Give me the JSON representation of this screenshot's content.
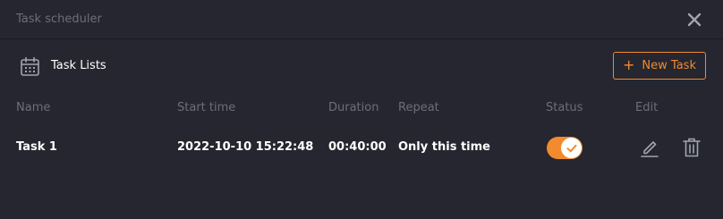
{
  "window": {
    "title": "Task scheduler"
  },
  "section": {
    "title": "Task Lists",
    "new_task_label": "New Task"
  },
  "table": {
    "columns": [
      "Name",
      "Start time",
      "Duration",
      "Repeat",
      "Status",
      "Edit"
    ],
    "rows": [
      {
        "name": "Task 1",
        "start_time": "2022-10-10 15:22:48",
        "duration": "00:40:00",
        "repeat": "Only this time",
        "status_enabled": true
      }
    ]
  },
  "colors": {
    "accent": "#f28a2e",
    "background": "#25262f",
    "muted_text": "#6c6e7a"
  },
  "icons": [
    "close-icon",
    "calendar-icon",
    "plus-icon",
    "check-icon",
    "edit-pencil-icon",
    "trash-icon"
  ]
}
